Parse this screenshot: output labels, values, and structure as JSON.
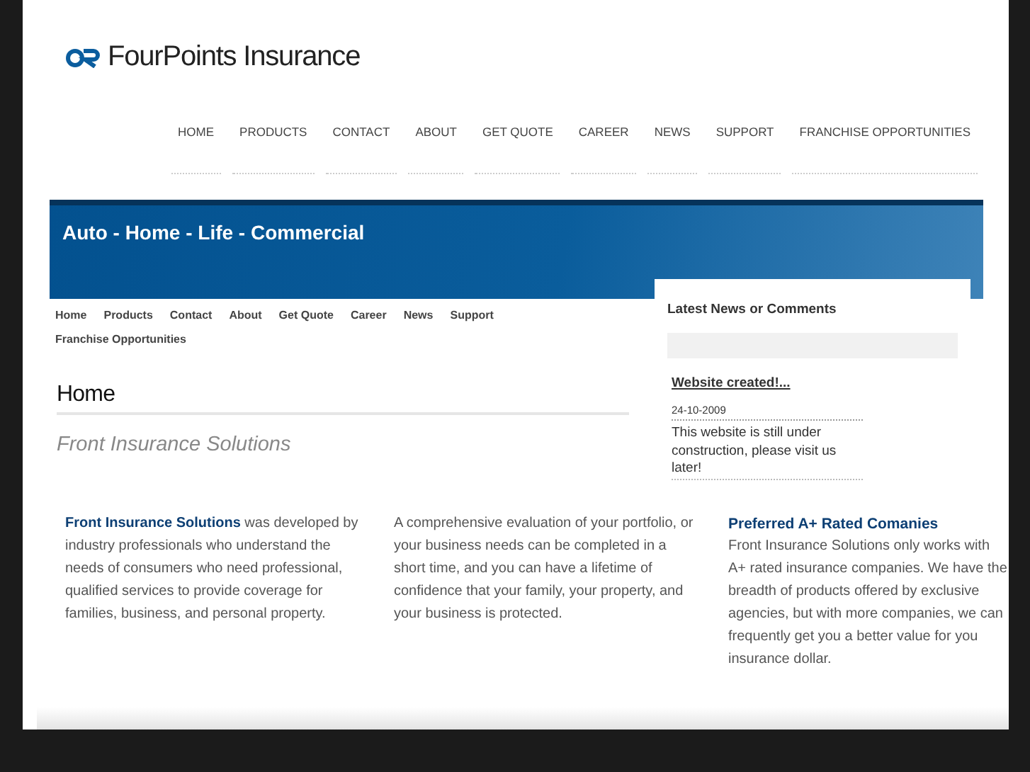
{
  "logo": {
    "text": "FourPoints Insurance"
  },
  "top_nav": [
    "HOME",
    "PRODUCTS",
    "CONTACT",
    "ABOUT",
    "GET QUOTE",
    "CAREER",
    "NEWS",
    "SUPPORT",
    "FRANCHISE OPPORTUNITIES"
  ],
  "banner": {
    "title": "Auto - Home - Life - Commercial"
  },
  "sub_nav": [
    "Home",
    "Products",
    "Contact",
    "About",
    "Get Quote",
    "Career",
    "News",
    "Support",
    "Franchise Opportunities"
  ],
  "page_title": "Home",
  "subtitle": "Front Insurance Solutions",
  "sidebar": {
    "title": "Latest News or Comments",
    "news": [
      {
        "title": "Website created!...",
        "date": "24-10-2009",
        "text": "This website is still under construction, please visit us later!"
      }
    ]
  },
  "columns": [
    {
      "text": "**Front Insurance Solutions** was developed by industry professionals who understand the needs of consumers who need professional, qualified services to provide coverage for families, business, and personal property."
    },
    {
      "text": "A comprehensive evaluation of your portfolio, or your business needs can be completed in a short time, and you can have a lifetime of confidence that your family, your property, and your business is protected."
    },
    {
      "heading": "Preferred A+ Rated Comanies",
      "text": "Front Insurance Solutions only works with A+ rated insurance companies.  We have the breadth of products offered by exclusive agencies, but with more companies, we can frequently get you a better value for you insurance dollar."
    }
  ]
}
